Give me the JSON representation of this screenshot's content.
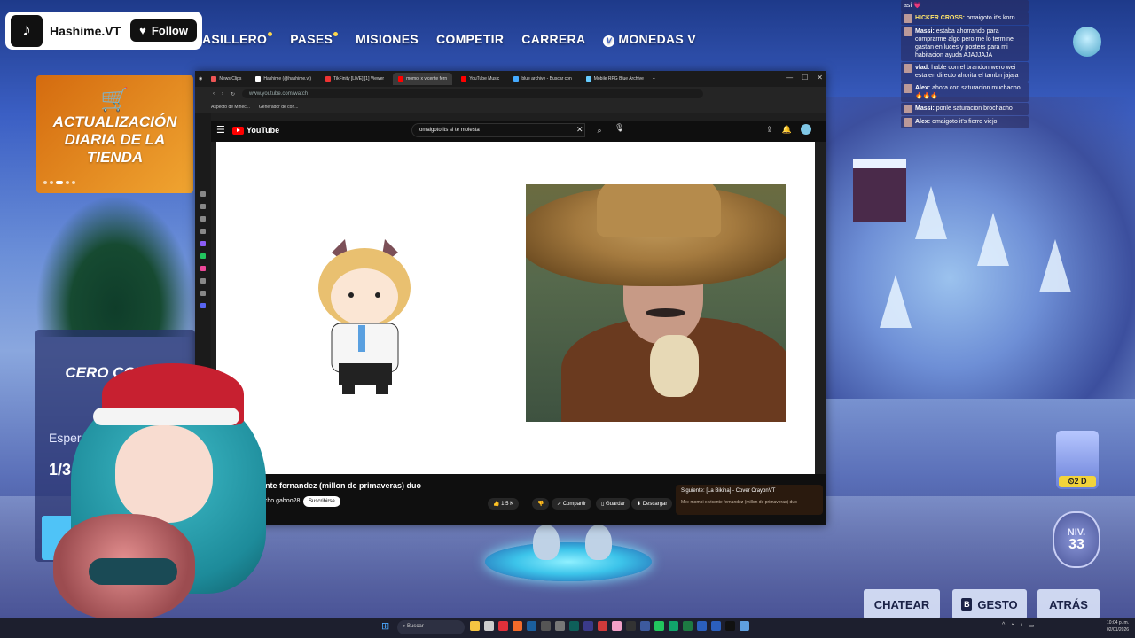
{
  "tiktok": {
    "logo": "♪",
    "name": "Hashime.VT",
    "follow_label": "Follow"
  },
  "game_nav": {
    "items": [
      "ASILLERO",
      "PASES",
      "MISIONES",
      "COMPETIR",
      "CARRERA",
      "MONEDAS V"
    ],
    "vbucks_icon": "V"
  },
  "shop_tile": {
    "title": "ACTUALIZACIÓN DIARIA DE LA TIENDA",
    "icon": "shopping-cart-icon"
  },
  "lobby_tile": {
    "title": "CERO CONST",
    "waiting_text": "Esperando jugador",
    "count": "1/3"
  },
  "browser": {
    "tabs": [
      {
        "label": "News Clips",
        "color": "#e55"
      },
      {
        "label": "Hashime (@hashime.vt)",
        "color": "#fff"
      },
      {
        "label": "TikFinity [LIVE] [1] Viewer",
        "color": "#e33"
      },
      {
        "label": "momoi x vicente fern",
        "color": "#f00"
      },
      {
        "label": "YouTube Music",
        "color": "#f00"
      },
      {
        "label": "blue archive - Buscar con",
        "color": "#4af"
      },
      {
        "label": "Mobile RPG Blue Archive",
        "color": "#6cf"
      }
    ],
    "active_tab_index": 3,
    "url": "www.youtube.com/watch",
    "bookmarks": [
      "Aspecto de Minec...",
      "Generador de con..."
    ],
    "window_controls": [
      "—",
      "☐",
      "✕"
    ]
  },
  "youtube": {
    "logo_text": "YouTube",
    "search_query": "omaigoto its si te molesta",
    "video_title": "ente fernandez (millon de primaveras) duo",
    "channel": "acho gaboo28",
    "subscribe_label": "Suscribirse",
    "likes": "1.5 K",
    "share_label": "Compartir",
    "save_label": "Guardar",
    "download_label": "Descargar",
    "next_up_title": "Siguiente: [La Bikina] - Cover CrayonVT",
    "next_up_subtitle": "Mix: momoi x vicente fernandez (millon de primaveras) duo"
  },
  "chat": [
    {
      "user": "",
      "text": "así 💗",
      "color": "#fff"
    },
    {
      "user": "HICKER CROSS:",
      "text": "omaigoto it's korn",
      "color": "#ffe66b"
    },
    {
      "user": "Massi:",
      "text": "estaba ahorrando para comprarme algo pero me lo termine gastan en luces y posters para mi habitacion ayuda AJAJJAJA",
      "color": "#fff"
    },
    {
      "user": "vlad:",
      "text": "hable con el brandon wero wei esta en directo ahorita el tambn jajaja",
      "color": "#fff"
    },
    {
      "user": "Alex:",
      "text": "ahora con saturacion muchacho🔥🔥🔥",
      "color": "#fff"
    },
    {
      "user": "Massi:",
      "text": "ponle saturacion brochacho",
      "color": "#fff"
    },
    {
      "user": "Alex:",
      "text": "omaigoto it's fierro viejo",
      "color": "#fff"
    }
  ],
  "hud": {
    "reward_days": "⏲2 D",
    "level_label": "NIV.",
    "level_value": "33",
    "chat_button": "CHATEAR",
    "emote_key": "B",
    "emote_button": "GESTO",
    "back_button": "ATRÁS"
  },
  "taskbar": {
    "search_placeholder": "Buscar",
    "clock_time": "10:04 p. m.",
    "clock_date": "02/01/2026"
  }
}
